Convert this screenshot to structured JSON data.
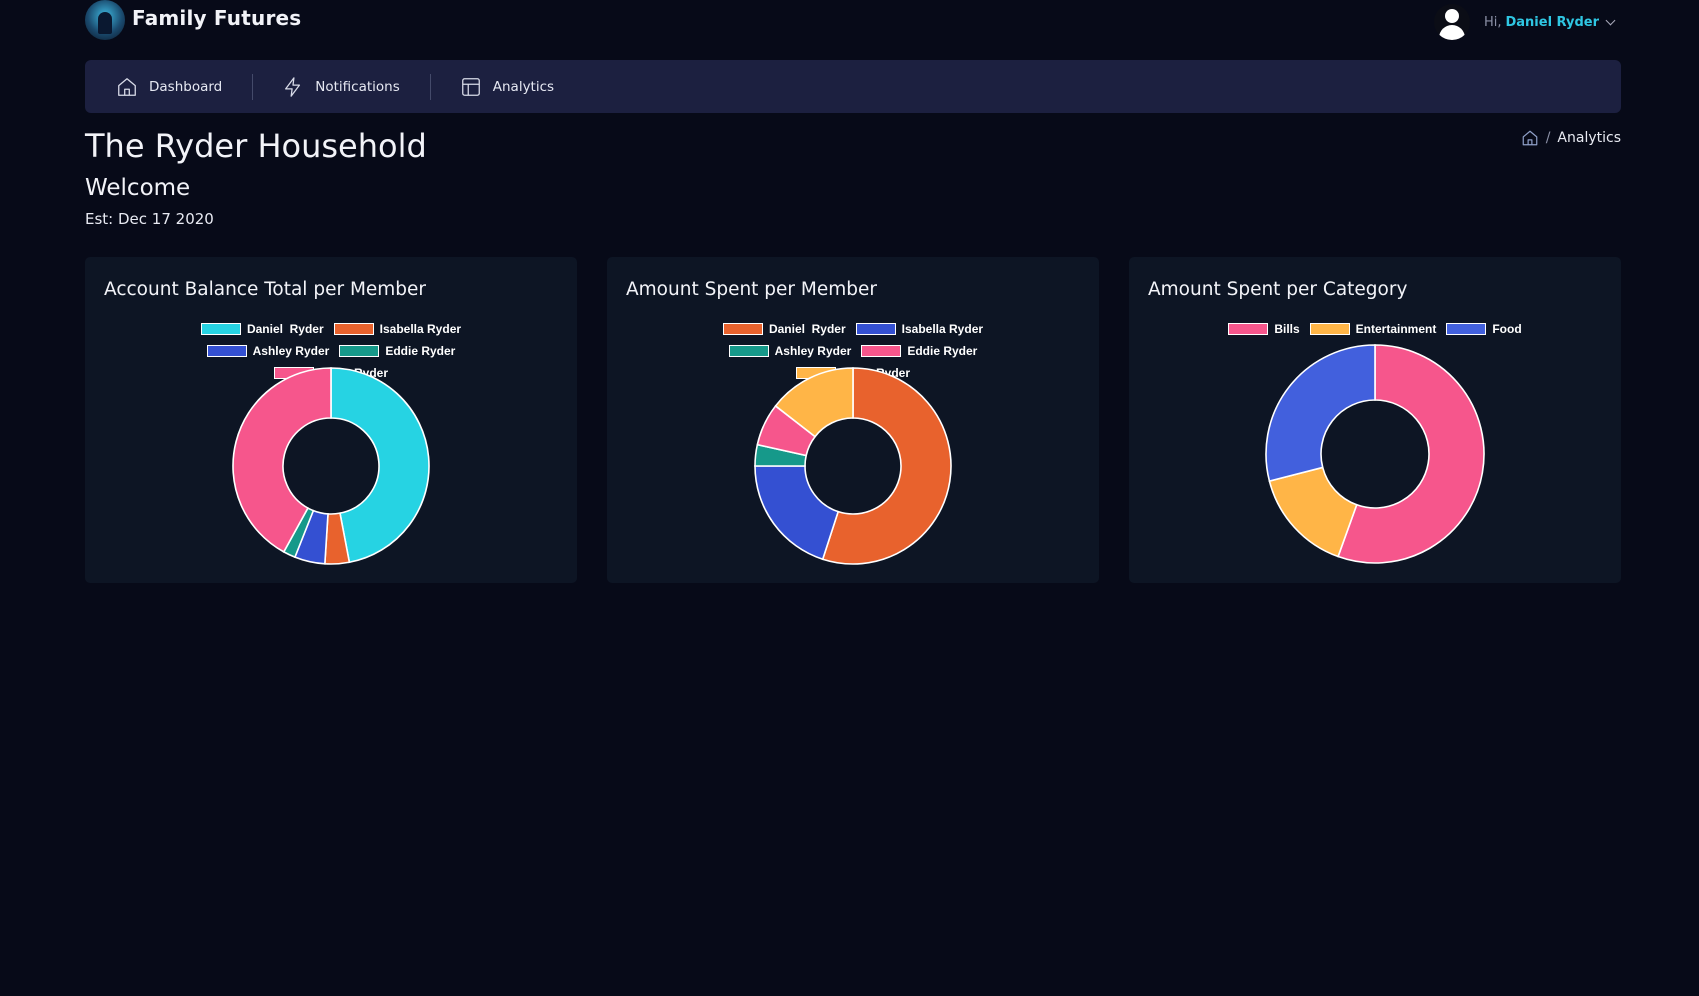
{
  "app": {
    "name": "Family Futures"
  },
  "user": {
    "greeting": "Hi,",
    "name": "Daniel Ryder"
  },
  "nav": [
    {
      "label": "Dashboard",
      "icon": "home-icon"
    },
    {
      "label": "Notifications",
      "icon": "lightning-icon"
    },
    {
      "label": "Analytics",
      "icon": "layout-icon"
    }
  ],
  "page": {
    "title": "The Ryder Household",
    "subtitle": "Welcome",
    "established": "Est: Dec 17 2020"
  },
  "breadcrumb": {
    "separator": "/",
    "current": "Analytics",
    "home_icon": "home-icon"
  },
  "chart_data": [
    {
      "type": "pie",
      "style": "doughnut",
      "title": "Account Balance Total per Member",
      "legend": "top",
      "categories": [
        "Daniel  Ryder",
        "Isabella Ryder",
        "Ashley Ryder",
        "Eddie Ryder",
        "Layla Ryder"
      ],
      "values": [
        47,
        4,
        5,
        2,
        42
      ],
      "colors": [
        "#26d3e3",
        "#e8622d",
        "#3450d2",
        "#16998a",
        "#f6568c"
      ]
    },
    {
      "type": "pie",
      "style": "doughnut",
      "title": "Amount Spent per Member",
      "legend": "top",
      "categories": [
        "Daniel  Ryder",
        "Isabella Ryder",
        "Ashley Ryder",
        "Eddie Ryder",
        "Layla Ryder"
      ],
      "values": [
        55,
        20,
        3.5,
        7,
        14.5
      ],
      "colors": [
        "#e8622d",
        "#3450d2",
        "#16998a",
        "#f6568c",
        "#ffb547"
      ]
    },
    {
      "type": "pie",
      "style": "doughnut",
      "title": "Amount Spent per Category",
      "legend": "top",
      "categories": [
        "Bills",
        "Entertainment",
        "Food"
      ],
      "values": [
        55.5,
        15.5,
        29
      ],
      "colors": [
        "#f6568c",
        "#ffb547",
        "#4260dd"
      ]
    }
  ]
}
